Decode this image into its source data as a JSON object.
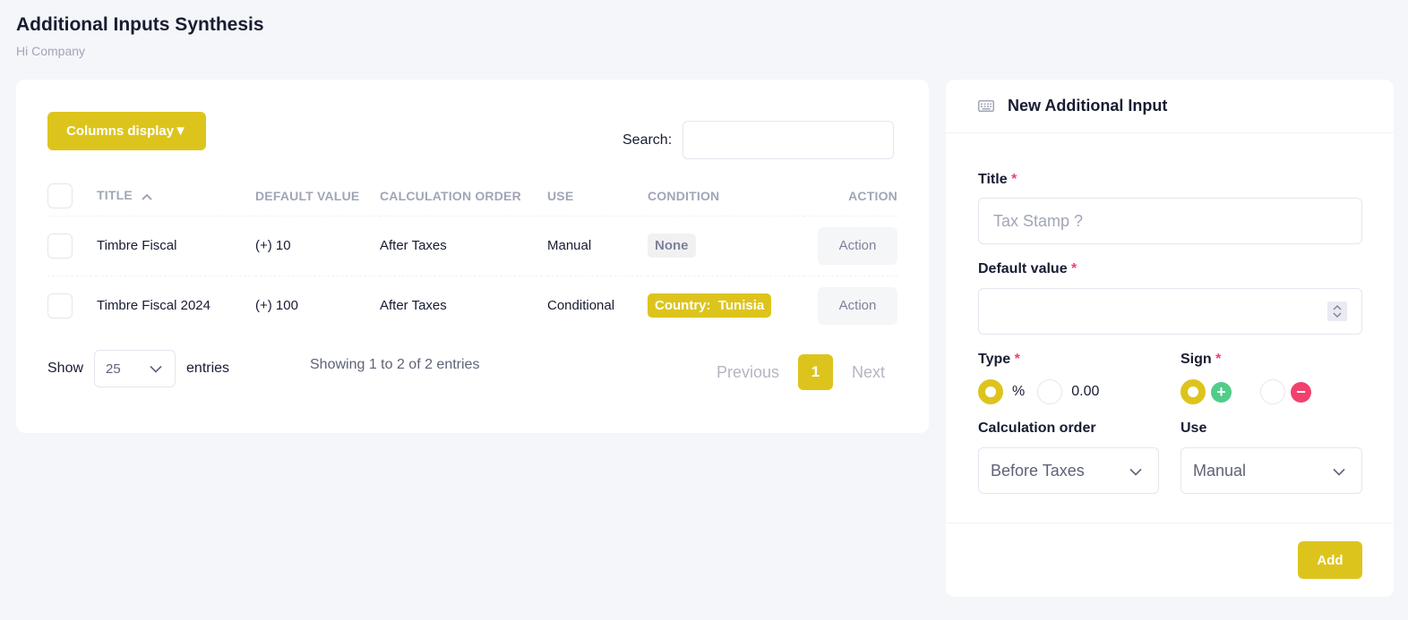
{
  "page": {
    "title": "Additional Inputs Synthesis",
    "subtitle": "Hi Company"
  },
  "table_card": {
    "columns_display_label": "Columns display▼",
    "search_label": "Search:",
    "search_value": "",
    "headers": {
      "title": "TITLE",
      "default_value": "DEFAULT VALUE",
      "calculation_order": "CALCULATION ORDER",
      "use": "USE",
      "condition": "CONDITION",
      "action": "ACTION"
    },
    "rows": [
      {
        "title": "Timbre Fiscal",
        "default_value": "(+) 10",
        "calculation_order": "After Taxes",
        "use": "Manual",
        "condition": "None",
        "action": "Action"
      },
      {
        "title": "Timbre Fiscal 2024",
        "default_value": "(+) 100",
        "calculation_order": "After Taxes",
        "use": "Conditional",
        "condition": "Country:  Tunisia",
        "action": "Action"
      }
    ],
    "footer": {
      "show_label": "Show",
      "page_length": "25",
      "entries_label": "entries",
      "info": "Showing 1 to 2 of 2 entries",
      "previous_label": "Previous",
      "current_page": "1",
      "next_label": "Next"
    }
  },
  "form_card": {
    "title": "New Additional Input",
    "title_label": "Title",
    "title_placeholder": "Tax Stamp ?",
    "default_value_label": "Default value",
    "required_mark": "*",
    "type_label": "Type",
    "type_options": [
      "%",
      "0.00"
    ],
    "type_selected": "%",
    "sign_label": "Sign",
    "sign_options": [
      "+",
      "−"
    ],
    "sign_selected": "+",
    "calc_order_label": "Calculation order",
    "calc_order_value": "Before Taxes",
    "use_label": "Use",
    "use_value": "Manual",
    "add_label": "Add"
  },
  "colors": {
    "accent": "#ddc41d",
    "success": "#50cd89",
    "danger": "#f1416c"
  }
}
